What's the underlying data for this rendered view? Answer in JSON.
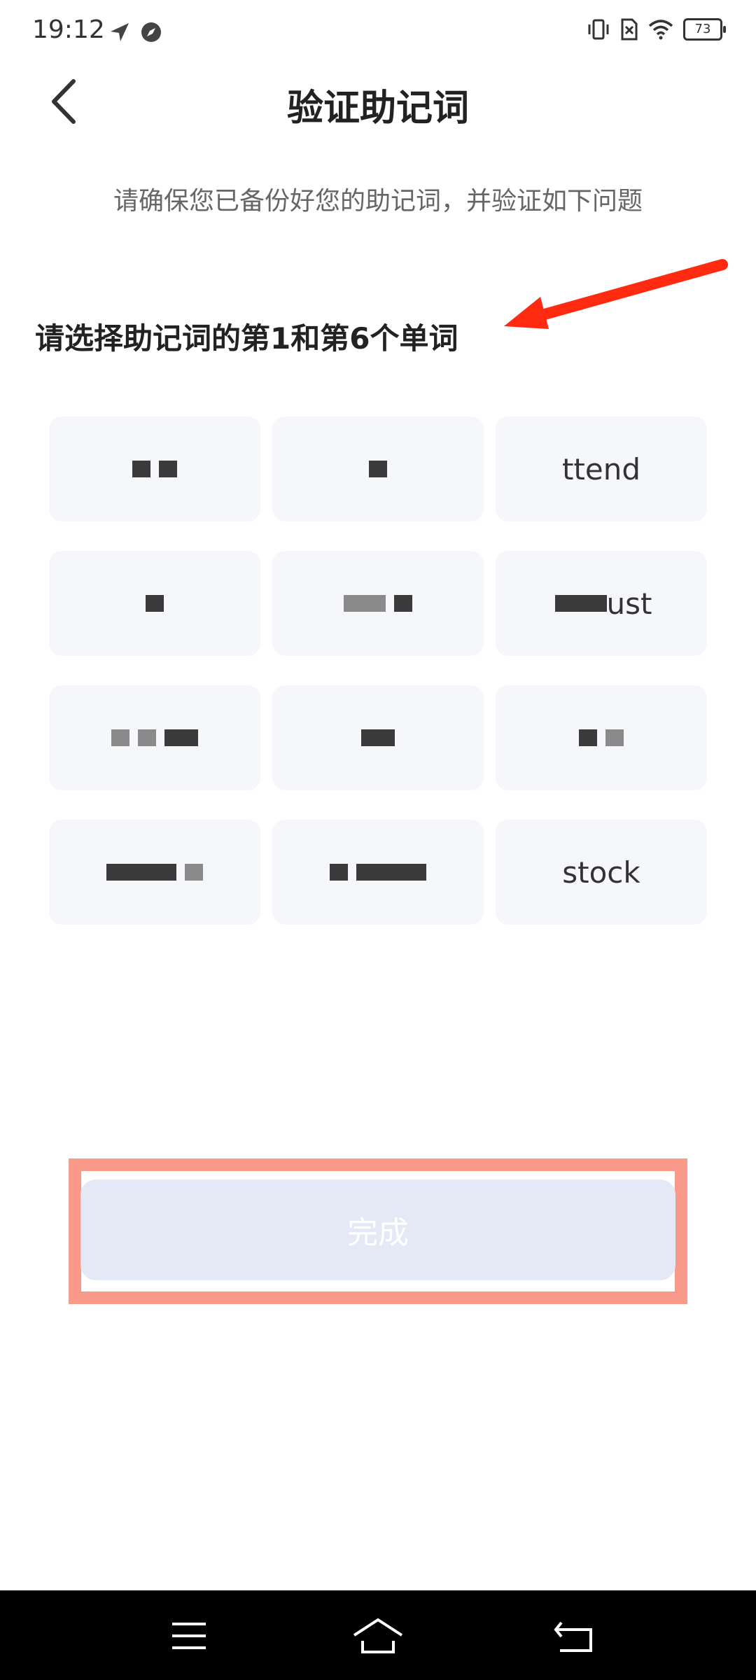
{
  "status": {
    "time": "19:12",
    "battery": "73",
    "icons": [
      "location-arrow-icon",
      "compass-icon",
      "vibrate-icon",
      "no-sim-icon",
      "wifi-icon",
      "battery-icon"
    ]
  },
  "header": {
    "title": "验证助记词",
    "back_icon": "chevron-left-icon"
  },
  "subtitle": "请确保您已备份好您的助记词，并验证如下问题",
  "instruction": "请选择助记词的第1和第6个单词",
  "annotation_arrow_color": "#ff2a10",
  "words": [
    "",
    "",
    "ttend",
    "",
    "",
    "ust",
    "",
    "",
    "",
    "",
    "",
    "stock"
  ],
  "complete_button": {
    "label": "完成",
    "highlight_color": "#f9998a",
    "background": "#e5e9f6"
  },
  "nav": {
    "icons": [
      "menu-icon",
      "home-icon",
      "back-arrow-icon"
    ]
  }
}
